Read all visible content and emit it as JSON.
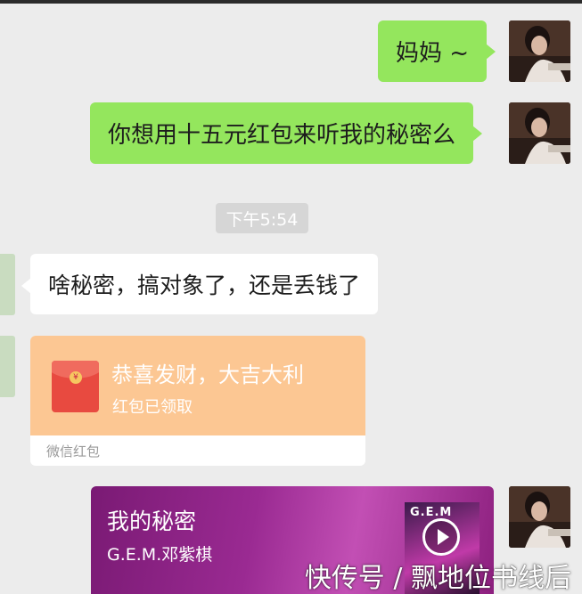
{
  "colors": {
    "background": "#ececec",
    "sent_bubble": "#94e65d",
    "received_bubble": "#ffffff",
    "red_packet": "#fcc793",
    "music_card": "#9a2a92"
  },
  "messages": [
    {
      "side": "right",
      "text": "妈妈 ~"
    },
    {
      "side": "right",
      "text": "你想用十五元红包来听我的秘密么"
    },
    {
      "side": "left",
      "text": "啥秘密，搞对象了，还是丢钱了"
    }
  ],
  "timestamp": "下午5:54",
  "red_packet": {
    "title": "恭喜发财，大吉大利",
    "status": "红包已领取",
    "footer": "微信红包"
  },
  "music_card": {
    "title": "我的秘密",
    "artist": "G.E.M.邓紫棋",
    "cover_logo": "G.E.M"
  },
  "watermark": "快传号 / 飘地位书线后"
}
